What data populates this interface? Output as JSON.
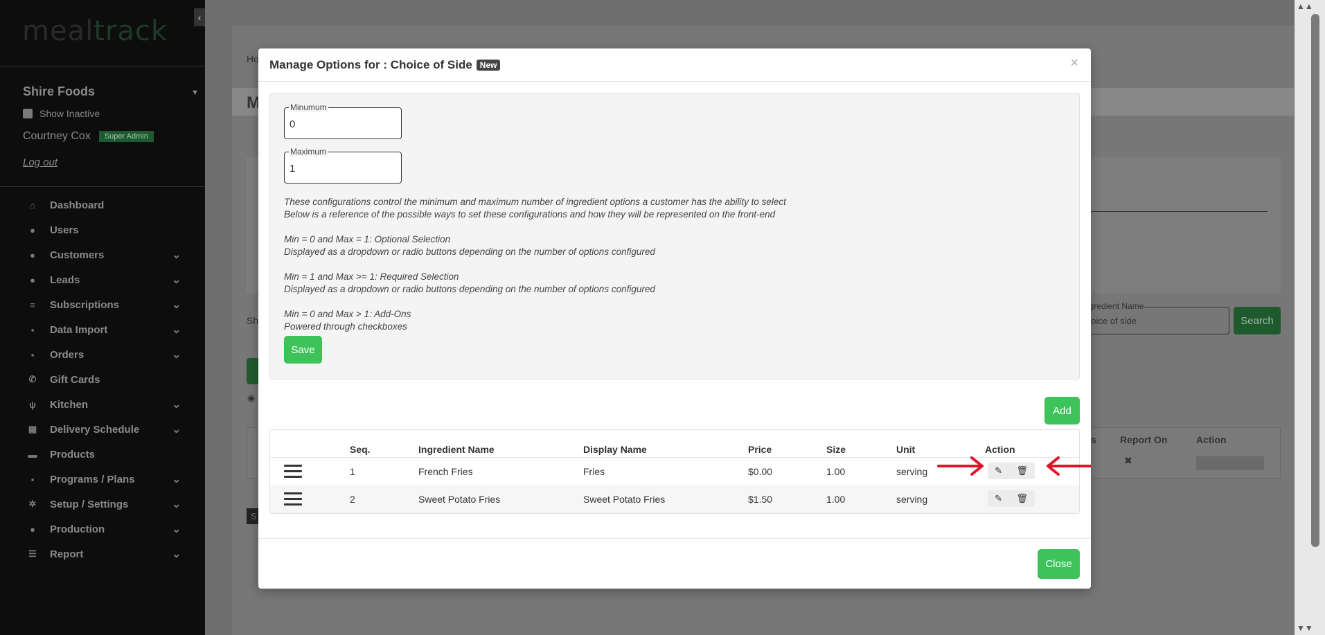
{
  "sidebar": {
    "logo_part1": "meal",
    "logo_part2": "track",
    "collapse_glyph": "‹",
    "company": "Shire Foods",
    "show_inactive": "Show Inactive",
    "user_name": "Courtney Cox",
    "user_role": "Super Admin",
    "logout": "Log out",
    "items": [
      {
        "label": "Dashboard",
        "icon": "home-icon",
        "glyph": "⌂",
        "caret": false
      },
      {
        "label": "Users",
        "icon": "user-icon",
        "glyph": "●",
        "caret": false
      },
      {
        "label": "Customers",
        "icon": "users-icon",
        "glyph": "●",
        "caret": true
      },
      {
        "label": "Leads",
        "icon": "info-icon",
        "glyph": "●",
        "caret": true
      },
      {
        "label": "Subscriptions",
        "icon": "layers-icon",
        "glyph": "≡",
        "caret": true
      },
      {
        "label": "Data Import",
        "icon": "file-icon",
        "glyph": "▪",
        "caret": true
      },
      {
        "label": "Orders",
        "icon": "bag-icon",
        "glyph": "▪",
        "caret": true
      },
      {
        "label": "Gift Cards",
        "icon": "phone-icon",
        "glyph": "✆",
        "caret": false
      },
      {
        "label": "Kitchen",
        "icon": "utensils-icon",
        "glyph": "ψ",
        "caret": true
      },
      {
        "label": "Delivery Schedule",
        "icon": "calendar-icon",
        "glyph": "▦",
        "caret": true
      },
      {
        "label": "Products",
        "icon": "box-icon",
        "glyph": "▬",
        "caret": false
      },
      {
        "label": "Programs / Plans",
        "icon": "clipboard-icon",
        "glyph": "▪",
        "caret": true
      },
      {
        "label": "Setup / Settings",
        "icon": "gear-icon",
        "glyph": "✲",
        "caret": true
      },
      {
        "label": "Production",
        "icon": "user-icon",
        "glyph": "●",
        "caret": true
      },
      {
        "label": "Report",
        "icon": "list-icon",
        "glyph": "☰",
        "caret": true
      }
    ]
  },
  "background": {
    "breadcrumb": "Ho",
    "page_title_fragment": "M",
    "ingredient_name_label": "ngredient Name",
    "ingredient_name_value": "hoice of side",
    "search_button": "Search",
    "report_on_header": "Report On",
    "action_header": "Action",
    "s_header": "s",
    "sh_text": "Sh",
    "s_btn": "S"
  },
  "modal": {
    "title": "Manage Options for : Choice of Side",
    "badge": "New",
    "close_x": "×",
    "minimum_label": "Minumum",
    "minimum_value": "0",
    "maximum_label": "Maximum",
    "maximum_value": "1",
    "help_lines": [
      "These configurations control the minimum and maximum number of ingredient options a customer has the ability to select",
      "Below is a reference of the possible ways to set these configurations and how they will be represented on the front-end",
      "",
      "Min = 0 and Max = 1: Optional Selection",
      "Displayed as a dropdown or radio buttons depending on the number of options configured",
      "",
      "Min = 1 and Max >= 1: Required Selection",
      "Displayed as a dropdown or radio buttons depending on the number of options configured",
      "",
      "Min = 0 and Max > 1: Add-Ons",
      "Powered through checkboxes"
    ],
    "save_button": "Save",
    "add_button": "Add",
    "close_button": "Close",
    "table": {
      "headers": [
        "Seq.",
        "Ingredient Name",
        "Display Name",
        "Price",
        "Size",
        "Unit",
        "Action"
      ],
      "rows": [
        {
          "seq": "1",
          "ingredient": "French Fries",
          "display": "Fries",
          "price": "$0.00",
          "size": "1.00",
          "unit": "serving"
        },
        {
          "seq": "2",
          "ingredient": "Sweet Potato Fries",
          "display": "Sweet Potato Fries",
          "price": "$1.50",
          "size": "1.00",
          "unit": "serving"
        }
      ]
    },
    "edit_glyph": "✎",
    "delete_glyph": "🗑"
  },
  "colors": {
    "accent_green": "#3dc35a",
    "annotation_red": "#e0132a"
  }
}
